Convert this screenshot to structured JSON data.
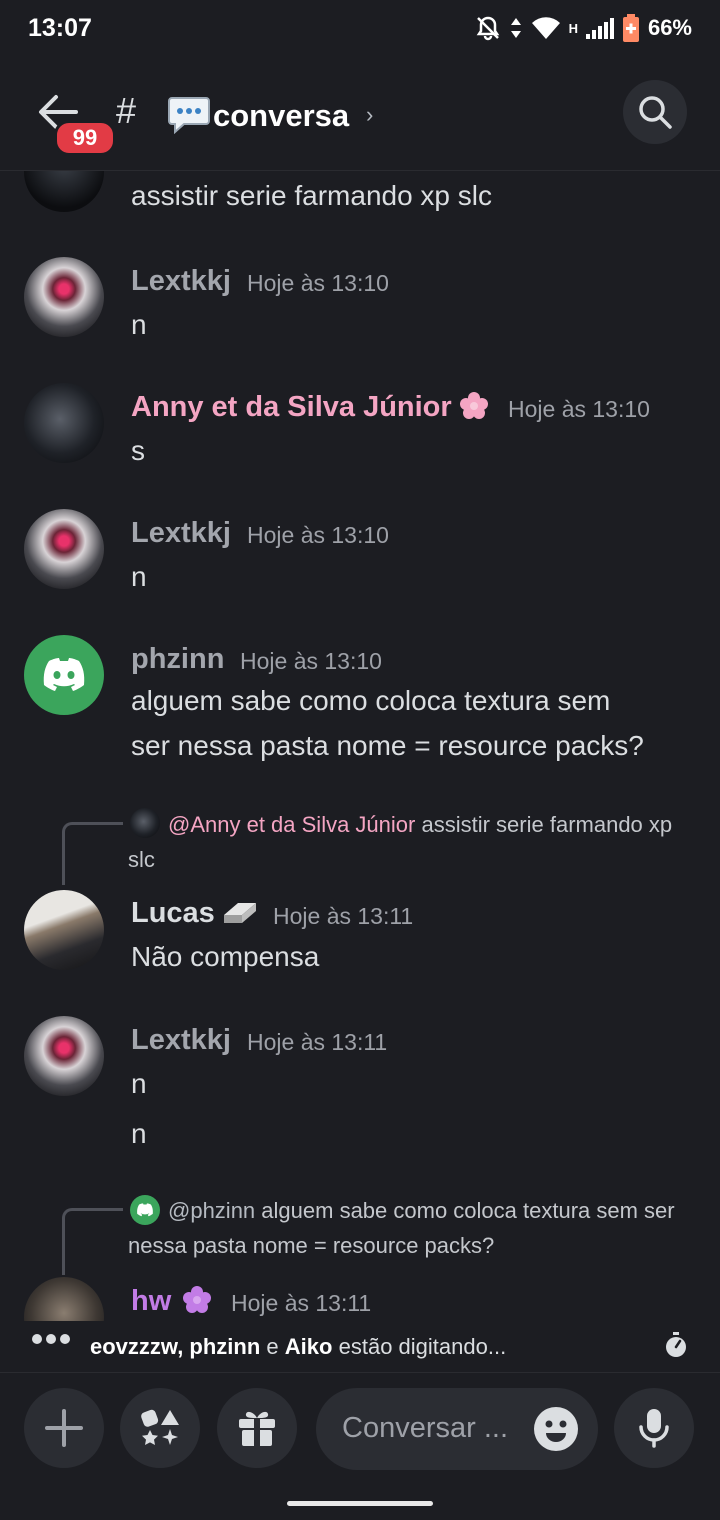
{
  "status_bar": {
    "time": "13:07",
    "network": "H",
    "battery": "66%"
  },
  "header": {
    "unread_badge": "99",
    "hash": "#",
    "channel_name": "conversa",
    "chevron": "›"
  },
  "messages": [
    {
      "text": "assistir serie farmando xp slc"
    },
    {
      "username": "Lextkkj",
      "timestamp": "Hoje às 13:10",
      "lines": [
        "n"
      ]
    },
    {
      "username": "Anny et da Silva Júnior",
      "name_color": "#f4a5c3",
      "timestamp": "Hoje às 13:10",
      "lines": [
        "s"
      ]
    },
    {
      "username": "Lextkkj",
      "timestamp": "Hoje às 13:10",
      "lines": [
        "n"
      ]
    },
    {
      "username": "phzinn",
      "timestamp": "Hoje às 13:10",
      "lines": [
        "alguem sabe como coloca textura sem",
        "ser nessa pasta nome =  resource packs?"
      ]
    },
    {
      "reply": {
        "mention": "@Anny et da Silva Júnior",
        "text": "assistir serie farmando xp slc"
      },
      "username": "Lucas",
      "timestamp": "Hoje às 13:11",
      "lines": [
        "Não compensa"
      ]
    },
    {
      "username": "Lextkkj",
      "timestamp": "Hoje às 13:11",
      "lines": [
        "n",
        "n"
      ]
    },
    {
      "reply": {
        "mention": "@phzinn",
        "text": "alguem sabe como coloca textura sem ser nessa pasta nome =  resource packs?"
      },
      "username": "hw",
      "name_color": "#c27ce6",
      "timestamp": "Hoje às 13:11"
    }
  ],
  "typing": {
    "names": "eovzzzw, phzinn",
    "connector": "e",
    "last_name": "Aiko",
    "suffix": "estão digitando..."
  },
  "composer": {
    "placeholder": "Conversar ..."
  },
  "colors": {
    "background": "#1c1d22",
    "pink_role": "#f4a5c3",
    "purple_role": "#c27ce6",
    "discord_green": "#3ba55c",
    "badge_red": "#e23b45"
  }
}
